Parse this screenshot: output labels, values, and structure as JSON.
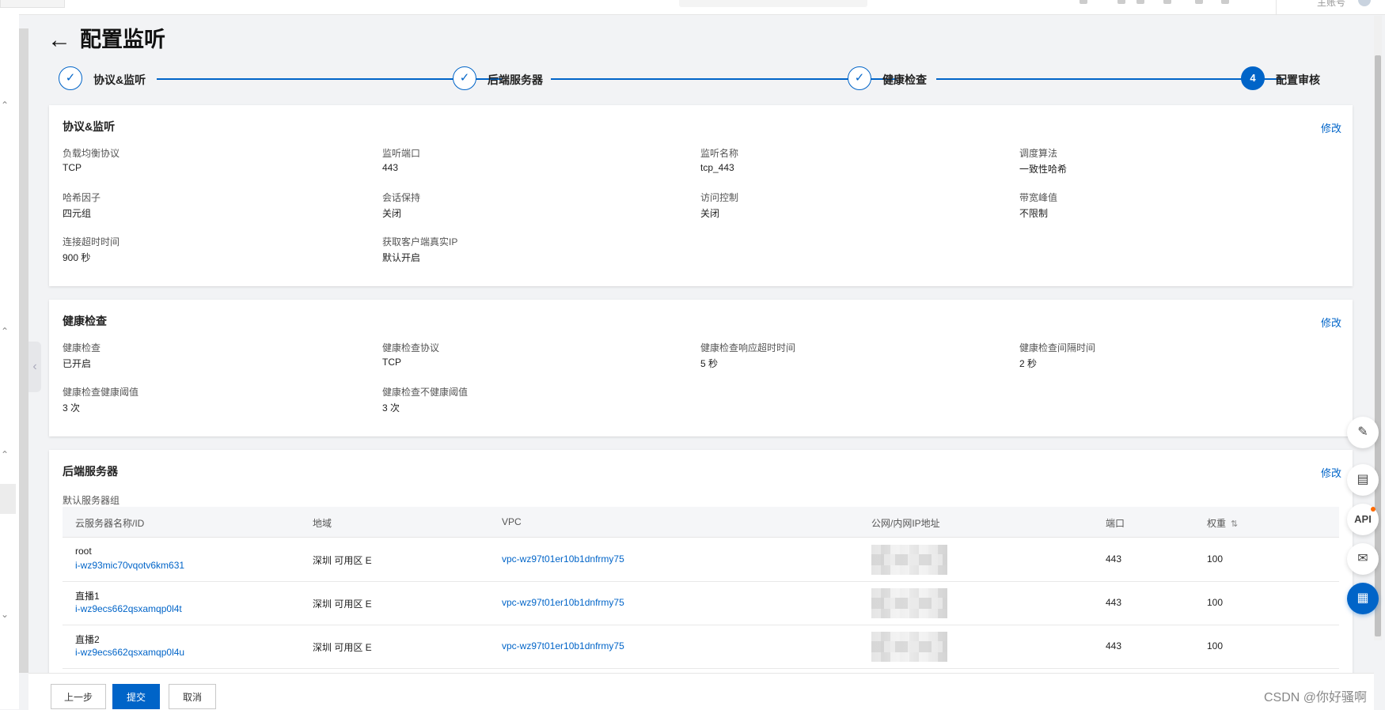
{
  "header": {
    "account": "主账号"
  },
  "page": {
    "title": "配置监听",
    "back_icon": "arrow-left-icon"
  },
  "steps": [
    {
      "label": "协议&监听",
      "state": "done",
      "icon": "check-icon"
    },
    {
      "label": "后端服务器",
      "state": "done",
      "icon": "check-icon"
    },
    {
      "label": "健康检查",
      "state": "done",
      "icon": "check-icon"
    },
    {
      "label": "配置审核",
      "state": "active",
      "number": "4"
    }
  ],
  "listener_card": {
    "title": "协议&监听",
    "edit": "修改",
    "fields": [
      {
        "label": "负载均衡协议",
        "value": "TCP"
      },
      {
        "label": "监听端口",
        "value": "443"
      },
      {
        "label": "监听名称",
        "value": "tcp_443"
      },
      {
        "label": "调度算法",
        "value": "一致性哈希"
      },
      {
        "label": "哈希因子",
        "value": "四元组"
      },
      {
        "label": "会话保持",
        "value": "关闭"
      },
      {
        "label": "访问控制",
        "value": "关闭"
      },
      {
        "label": "带宽峰值",
        "value": "不限制"
      },
      {
        "label": "连接超时时间",
        "value": "900 秒"
      },
      {
        "label": "获取客户端真实IP",
        "value": "默认开启"
      }
    ]
  },
  "health_card": {
    "title": "健康检查",
    "edit": "修改",
    "fields": [
      {
        "label": "健康检查",
        "value": "已开启"
      },
      {
        "label": "健康检查协议",
        "value": "TCP"
      },
      {
        "label": "健康检查响应超时时间",
        "value": "5 秒"
      },
      {
        "label": "健康检查间隔时间",
        "value": "2 秒"
      },
      {
        "label": "健康检查健康阈值",
        "value": "3 次"
      },
      {
        "label": "健康检查不健康阈值",
        "value": "3 次"
      }
    ]
  },
  "backend_card": {
    "title": "后端服务器",
    "edit": "修改",
    "group_name": "默认服务器组",
    "columns": [
      "云服务器名称/ID",
      "地域",
      "VPC",
      "公网/内网IP地址",
      "端口",
      "权重"
    ],
    "rows": [
      {
        "name": "root",
        "id": "i-wz93mic70vqotv6km631",
        "region": "深圳 可用区 E",
        "vpc": "vpc-wz97t01er10b1dnfrmy75",
        "port": "443",
        "weight": "100"
      },
      {
        "name": "直播1",
        "id": "i-wz9ecs662qsxamqp0l4t",
        "region": "深圳 可用区 E",
        "vpc": "vpc-wz97t01er10b1dnfrmy75",
        "port": "443",
        "weight": "100"
      },
      {
        "name": "直播2",
        "id": "i-wz9ecs662qsxamqp0l4u",
        "region": "深圳 可用区 E",
        "vpc": "vpc-wz97t01er10b1dnfrmy75",
        "port": "443",
        "weight": "100"
      }
    ]
  },
  "footer": {
    "prev": "上一步",
    "submit": "提交",
    "cancel": "取消"
  },
  "floating": [
    "edit-icon",
    "book-icon",
    "API",
    "chat-icon",
    "apps-icon"
  ],
  "watermark": "CSDN @你好骚啊",
  "colors": {
    "primary": "#0064c8",
    "notify": "#ff6a00"
  }
}
